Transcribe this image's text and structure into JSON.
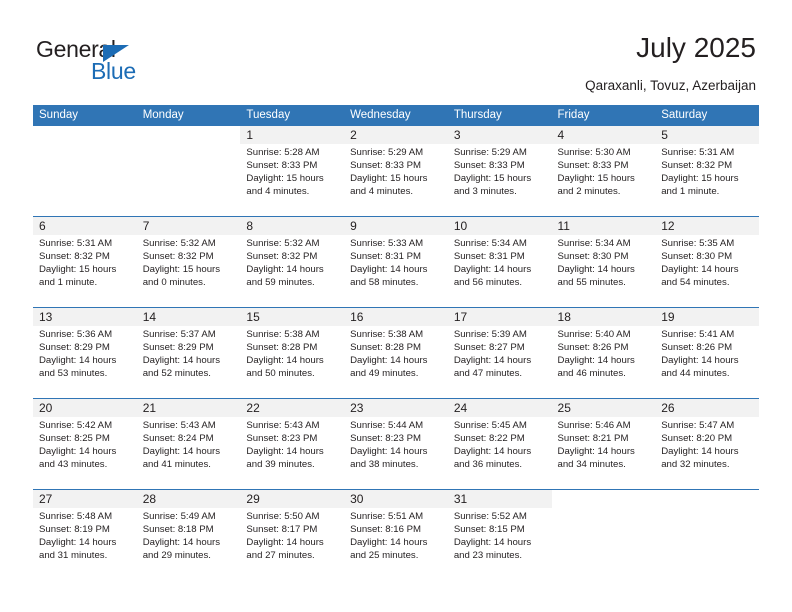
{
  "brand": {
    "name_top": "General",
    "name_bottom": "Blue",
    "accent_color": "#1c6cb5"
  },
  "header": {
    "title": "July 2025",
    "subtitle": "Qaraxanli, Tovuz, Azerbaijan",
    "header_bg": "#3075b5",
    "daynum_bg": "#f2f2f2"
  },
  "weekdays": [
    "Sunday",
    "Monday",
    "Tuesday",
    "Wednesday",
    "Thursday",
    "Friday",
    "Saturday"
  ],
  "labels": {
    "sunrise": "Sunrise:",
    "sunset": "Sunset:",
    "daylight": "Daylight:"
  },
  "weeks": [
    [
      {
        "day": ""
      },
      {
        "day": ""
      },
      {
        "day": "1",
        "sunrise": "Sunrise: 5:28 AM",
        "sunset": "Sunset: 8:33 PM",
        "daylight": "Daylight: 15 hours and 4 minutes."
      },
      {
        "day": "2",
        "sunrise": "Sunrise: 5:29 AM",
        "sunset": "Sunset: 8:33 PM",
        "daylight": "Daylight: 15 hours and 4 minutes."
      },
      {
        "day": "3",
        "sunrise": "Sunrise: 5:29 AM",
        "sunset": "Sunset: 8:33 PM",
        "daylight": "Daylight: 15 hours and 3 minutes."
      },
      {
        "day": "4",
        "sunrise": "Sunrise: 5:30 AM",
        "sunset": "Sunset: 8:33 PM",
        "daylight": "Daylight: 15 hours and 2 minutes."
      },
      {
        "day": "5",
        "sunrise": "Sunrise: 5:31 AM",
        "sunset": "Sunset: 8:32 PM",
        "daylight": "Daylight: 15 hours and 1 minute."
      }
    ],
    [
      {
        "day": "6",
        "sunrise": "Sunrise: 5:31 AM",
        "sunset": "Sunset: 8:32 PM",
        "daylight": "Daylight: 15 hours and 1 minute."
      },
      {
        "day": "7",
        "sunrise": "Sunrise: 5:32 AM",
        "sunset": "Sunset: 8:32 PM",
        "daylight": "Daylight: 15 hours and 0 minutes."
      },
      {
        "day": "8",
        "sunrise": "Sunrise: 5:32 AM",
        "sunset": "Sunset: 8:32 PM",
        "daylight": "Daylight: 14 hours and 59 minutes."
      },
      {
        "day": "9",
        "sunrise": "Sunrise: 5:33 AM",
        "sunset": "Sunset: 8:31 PM",
        "daylight": "Daylight: 14 hours and 58 minutes."
      },
      {
        "day": "10",
        "sunrise": "Sunrise: 5:34 AM",
        "sunset": "Sunset: 8:31 PM",
        "daylight": "Daylight: 14 hours and 56 minutes."
      },
      {
        "day": "11",
        "sunrise": "Sunrise: 5:34 AM",
        "sunset": "Sunset: 8:30 PM",
        "daylight": "Daylight: 14 hours and 55 minutes."
      },
      {
        "day": "12",
        "sunrise": "Sunrise: 5:35 AM",
        "sunset": "Sunset: 8:30 PM",
        "daylight": "Daylight: 14 hours and 54 minutes."
      }
    ],
    [
      {
        "day": "13",
        "sunrise": "Sunrise: 5:36 AM",
        "sunset": "Sunset: 8:29 PM",
        "daylight": "Daylight: 14 hours and 53 minutes."
      },
      {
        "day": "14",
        "sunrise": "Sunrise: 5:37 AM",
        "sunset": "Sunset: 8:29 PM",
        "daylight": "Daylight: 14 hours and 52 minutes."
      },
      {
        "day": "15",
        "sunrise": "Sunrise: 5:38 AM",
        "sunset": "Sunset: 8:28 PM",
        "daylight": "Daylight: 14 hours and 50 minutes."
      },
      {
        "day": "16",
        "sunrise": "Sunrise: 5:38 AM",
        "sunset": "Sunset: 8:28 PM",
        "daylight": "Daylight: 14 hours and 49 minutes."
      },
      {
        "day": "17",
        "sunrise": "Sunrise: 5:39 AM",
        "sunset": "Sunset: 8:27 PM",
        "daylight": "Daylight: 14 hours and 47 minutes."
      },
      {
        "day": "18",
        "sunrise": "Sunrise: 5:40 AM",
        "sunset": "Sunset: 8:26 PM",
        "daylight": "Daylight: 14 hours and 46 minutes."
      },
      {
        "day": "19",
        "sunrise": "Sunrise: 5:41 AM",
        "sunset": "Sunset: 8:26 PM",
        "daylight": "Daylight: 14 hours and 44 minutes."
      }
    ],
    [
      {
        "day": "20",
        "sunrise": "Sunrise: 5:42 AM",
        "sunset": "Sunset: 8:25 PM",
        "daylight": "Daylight: 14 hours and 43 minutes."
      },
      {
        "day": "21",
        "sunrise": "Sunrise: 5:43 AM",
        "sunset": "Sunset: 8:24 PM",
        "daylight": "Daylight: 14 hours and 41 minutes."
      },
      {
        "day": "22",
        "sunrise": "Sunrise: 5:43 AM",
        "sunset": "Sunset: 8:23 PM",
        "daylight": "Daylight: 14 hours and 39 minutes."
      },
      {
        "day": "23",
        "sunrise": "Sunrise: 5:44 AM",
        "sunset": "Sunset: 8:23 PM",
        "daylight": "Daylight: 14 hours and 38 minutes."
      },
      {
        "day": "24",
        "sunrise": "Sunrise: 5:45 AM",
        "sunset": "Sunset: 8:22 PM",
        "daylight": "Daylight: 14 hours and 36 minutes."
      },
      {
        "day": "25",
        "sunrise": "Sunrise: 5:46 AM",
        "sunset": "Sunset: 8:21 PM",
        "daylight": "Daylight: 14 hours and 34 minutes."
      },
      {
        "day": "26",
        "sunrise": "Sunrise: 5:47 AM",
        "sunset": "Sunset: 8:20 PM",
        "daylight": "Daylight: 14 hours and 32 minutes."
      }
    ],
    [
      {
        "day": "27",
        "sunrise": "Sunrise: 5:48 AM",
        "sunset": "Sunset: 8:19 PM",
        "daylight": "Daylight: 14 hours and 31 minutes."
      },
      {
        "day": "28",
        "sunrise": "Sunrise: 5:49 AM",
        "sunset": "Sunset: 8:18 PM",
        "daylight": "Daylight: 14 hours and 29 minutes."
      },
      {
        "day": "29",
        "sunrise": "Sunrise: 5:50 AM",
        "sunset": "Sunset: 8:17 PM",
        "daylight": "Daylight: 14 hours and 27 minutes."
      },
      {
        "day": "30",
        "sunrise": "Sunrise: 5:51 AM",
        "sunset": "Sunset: 8:16 PM",
        "daylight": "Daylight: 14 hours and 25 minutes."
      },
      {
        "day": "31",
        "sunrise": "Sunrise: 5:52 AM",
        "sunset": "Sunset: 8:15 PM",
        "daylight": "Daylight: 14 hours and 23 minutes."
      },
      {
        "day": ""
      },
      {
        "day": ""
      }
    ]
  ]
}
